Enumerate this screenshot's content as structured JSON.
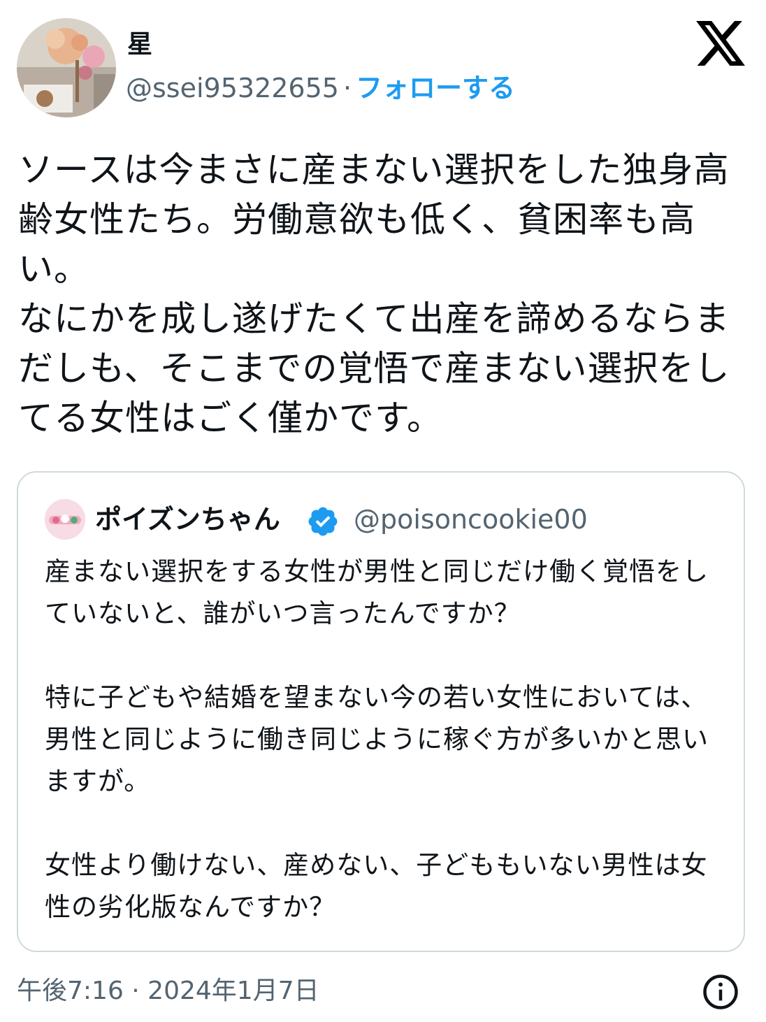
{
  "author": {
    "display_name": "星",
    "handle": "@ssei95322655",
    "separator": "·",
    "follow_label": "フォローする",
    "avatar_icon": "profile-photo-flowers"
  },
  "brand": {
    "logo_icon": "x-logo-icon"
  },
  "tweet": {
    "text": "ソースは今まさに産まない選択をした独身高齢女性たち。労働意欲も低く、貧困率も高い。\nなにかを成し遂げたくて出産を諦めるならまだしも、そこまでの覚悟で産まない選択をしてる女性はごく僅かです。"
  },
  "quote": {
    "display_name": "ポイズンちゃん",
    "handle": "@poisoncookie00",
    "verified_icon": "verified-badge-icon",
    "text": "産まない選択をする女性が男性と同じだけ働く覚悟をしていないと、誰がいつ言ったんですか？\n\n特に子どもや結婚を望まない今の若い女性においては、男性と同じように働き同じように稼ぐ方が多いかと思いますが。\n\n女性より働けない、産めない、子どももいない男性は女性の劣化版なんですか？"
  },
  "meta": {
    "timestamp": "午後7:16 · 2024年1月7日",
    "info_icon": "info-icon"
  },
  "colors": {
    "text": "#0f1419",
    "secondary": "#536471",
    "accent": "#1d9bf0",
    "border": "#cfd9de"
  }
}
